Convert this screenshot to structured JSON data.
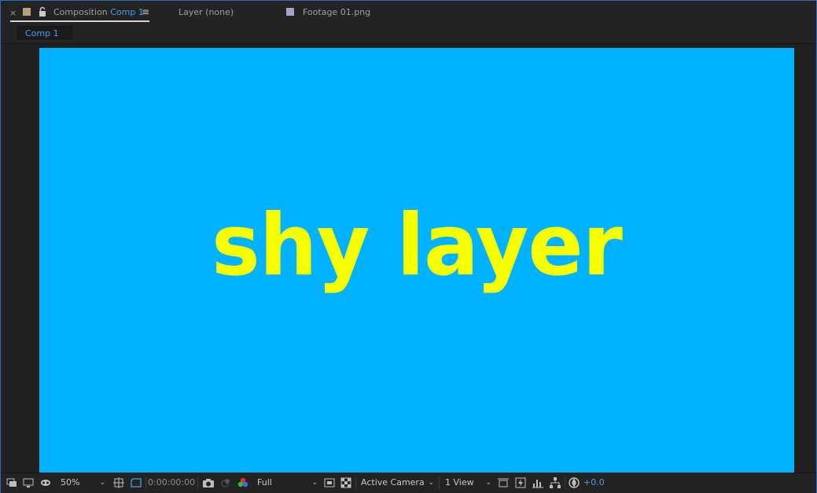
{
  "tabs": [
    {
      "close": "×",
      "prefix": "Composition",
      "name": "Comp 1",
      "active": true
    },
    {
      "prefix": "Layer",
      "name": "(none)"
    },
    {
      "prefix": "Footage",
      "name": "01.png"
    }
  ],
  "breadcrumb": "Comp 1",
  "composition": {
    "text": "shy layer",
    "background": "#00b2ff",
    "text_color": "#f6ff00"
  },
  "toolbar": {
    "zoom": "50%",
    "timecode": "0:00:00:00",
    "resolution": "Full",
    "camera": "Active Camera",
    "views": "1 View",
    "exposure": "+0.0"
  },
  "colors": {
    "accent": "#4c9be8",
    "panel_border": "#2d6bb8",
    "tab_swatch_comp": "#b4a07c",
    "tab_swatch_footage": "#a7a1c8"
  },
  "icons": [
    "close-icon",
    "label-swatch-icon",
    "lock-icon",
    "panel-menu-icon",
    "always-preview-icon",
    "monitor-icon",
    "mask-visibility-icon",
    "grid-guides-icon",
    "region-of-interest-icon",
    "snapshot-camera-icon",
    "show-snapshot-icon",
    "color-channels-icon",
    "toggle-transparency-grid-icon",
    "fast-previews-icon",
    "draft-3d-icon",
    "flowchart-icon",
    "reset-exposure-icon"
  ]
}
